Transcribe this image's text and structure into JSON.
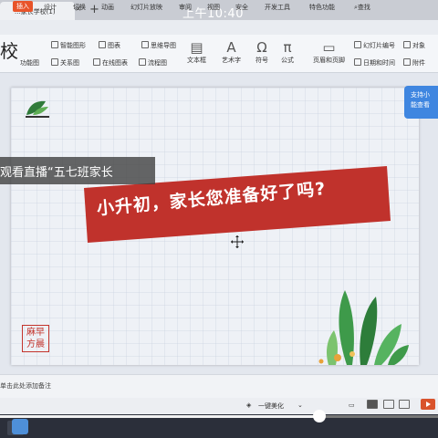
{
  "app": {
    "tab_title": "...家长学校(1)",
    "clock": "上午10:40",
    "new_tab_glyph": "+",
    "close_glyph": "×"
  },
  "menu": {
    "items": [
      "插入",
      "设计",
      "切换",
      "动画",
      "幻灯片放映",
      "审阅",
      "视图",
      "安全",
      "开发工具",
      "特色功能",
      "查找"
    ],
    "active": "插入"
  },
  "ribbon": {
    "big_char": "校",
    "tools": {
      "smart_graphic": "智能图形",
      "chart": "图表",
      "mind_map": "思维导图",
      "function_graph": "功能图",
      "relation_graph": "关系图",
      "online_chart": "在线图表",
      "flowchart": "流程图",
      "textbox": "文本框",
      "art_text": "艺术字",
      "symbol": "符号",
      "formula": "公式",
      "header_footer": "页眉和页脚",
      "slide_number": "幻灯片编号",
      "object": "对象",
      "date_time": "日期和时间",
      "attachment": "附件"
    }
  },
  "slide": {
    "banner_text": "小升初，家长您准备好了吗?",
    "live_text": "观看直播“五七班家长",
    "notice_text": [
      "支持小",
      "能查看"
    ],
    "seal_text": [
      "麻",
      "早",
      "方",
      "晨"
    ]
  },
  "notes": {
    "placeholder": "单击此处添加备注"
  },
  "status": {
    "beautify": "一键美化"
  },
  "player": {
    "progress": 0.73
  },
  "colors": {
    "accent": "#e8542a",
    "banner_red": "#c0322c",
    "notice_blue": "#3f86e0",
    "leaf_green": "#3e9a4a"
  },
  "icons": {
    "cursor": "move-cursor-icon",
    "logo": "leaf-logo-icon"
  }
}
